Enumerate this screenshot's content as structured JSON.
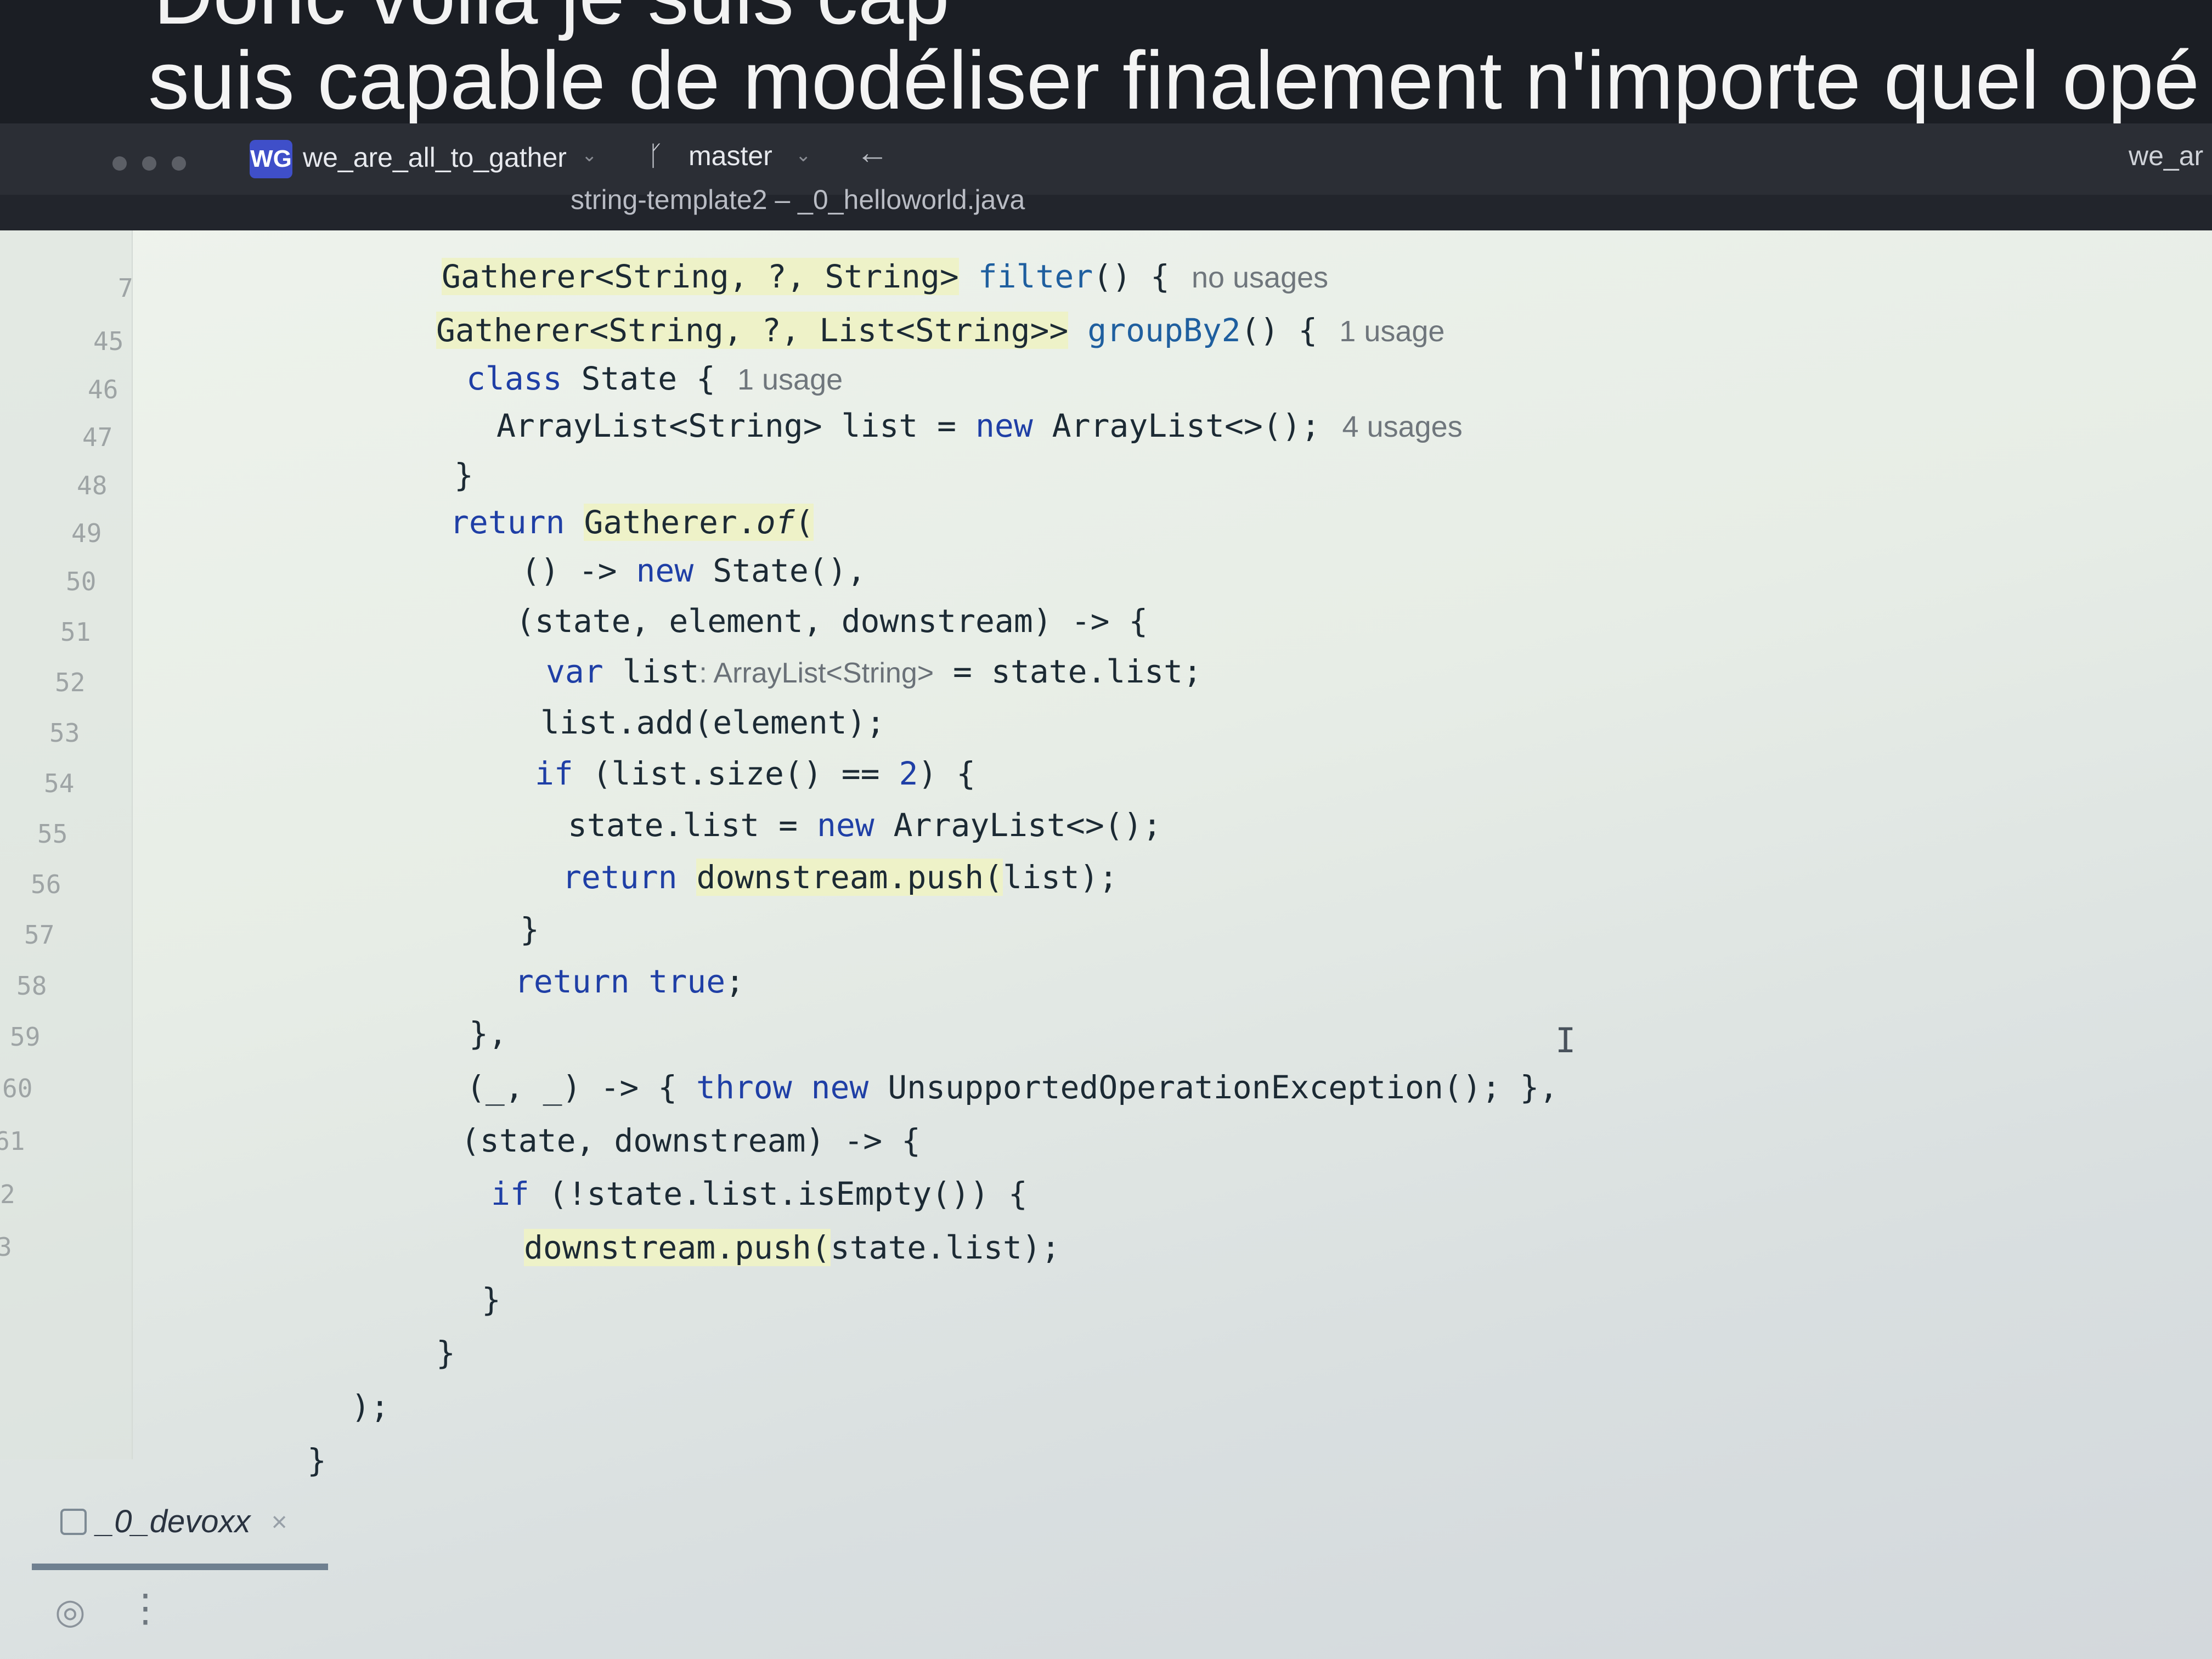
{
  "slide_caption": {
    "line1": "Donc voilà je suis cap",
    "line2": "suis capable de modéliser finalement n'importe quel opé"
  },
  "titlebar": {
    "project_badge": "WG",
    "project_name": "we_are_all_to_gather",
    "branch_name": "master",
    "right_project": "we_ar",
    "file_title": "string-template2 – _0_helloworld.java"
  },
  "editor": {
    "lines": [
      {
        "num": "7",
        "hint": "no usages"
      },
      {
        "num": "45",
        "hint": "1 usage"
      },
      {
        "num": "46",
        "hint": "1 usage"
      },
      {
        "num": "47",
        "hint": "4 usages"
      },
      {
        "num": "48"
      },
      {
        "num": "49"
      },
      {
        "num": "50"
      },
      {
        "num": "51"
      },
      {
        "num": "52",
        "type_hint": ": ArrayList<String>"
      },
      {
        "num": "53"
      },
      {
        "num": "54"
      },
      {
        "num": "55"
      },
      {
        "num": "56"
      },
      {
        "num": "57"
      },
      {
        "num": "58"
      },
      {
        "num": "59"
      },
      {
        "num": "60"
      },
      {
        "num": "61"
      },
      {
        "num": "2"
      },
      {
        "num": "3"
      }
    ]
  },
  "bottom_tab": {
    "label": "_0_devoxx",
    "close": "×"
  },
  "icons": {
    "camera": "camera-icon",
    "more": "more-vertical-icon",
    "branch": "git-branch-icon",
    "back": "back-arrow-icon",
    "cursor": "text-cursor-icon"
  }
}
